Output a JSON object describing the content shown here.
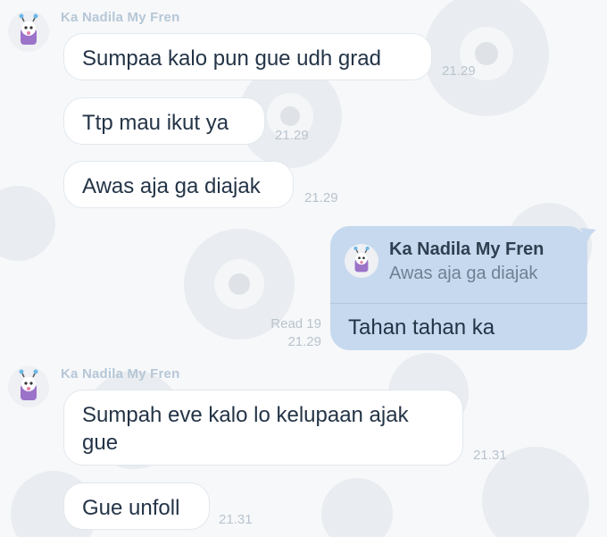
{
  "sender": {
    "name": "Ka Nadila My Fren"
  },
  "messages": [
    {
      "text": "Sumpaa kalo pun gue udh grad",
      "time": "21.29"
    },
    {
      "text": "Ttp mau ikut ya",
      "time": "21.29"
    },
    {
      "text": "Awas aja ga diajak",
      "time": "21.29"
    },
    {
      "text": "Sumpah eve kalo lo kelupaan ajak gue",
      "time": "21.31"
    },
    {
      "text": "Gue unfoll",
      "time": "21.31"
    }
  ],
  "outgoing": {
    "reply_to": {
      "name": "Ka Nadila My Fren",
      "text": "Awas aja ga diajak"
    },
    "text": "Tahan tahan ka",
    "read": "Read 19",
    "time": "21.29"
  },
  "colors": {
    "outgoing_bubble": "#c6d9ee",
    "incoming_bubble": "#ffffff",
    "sender_name": "#b6c7d6"
  }
}
